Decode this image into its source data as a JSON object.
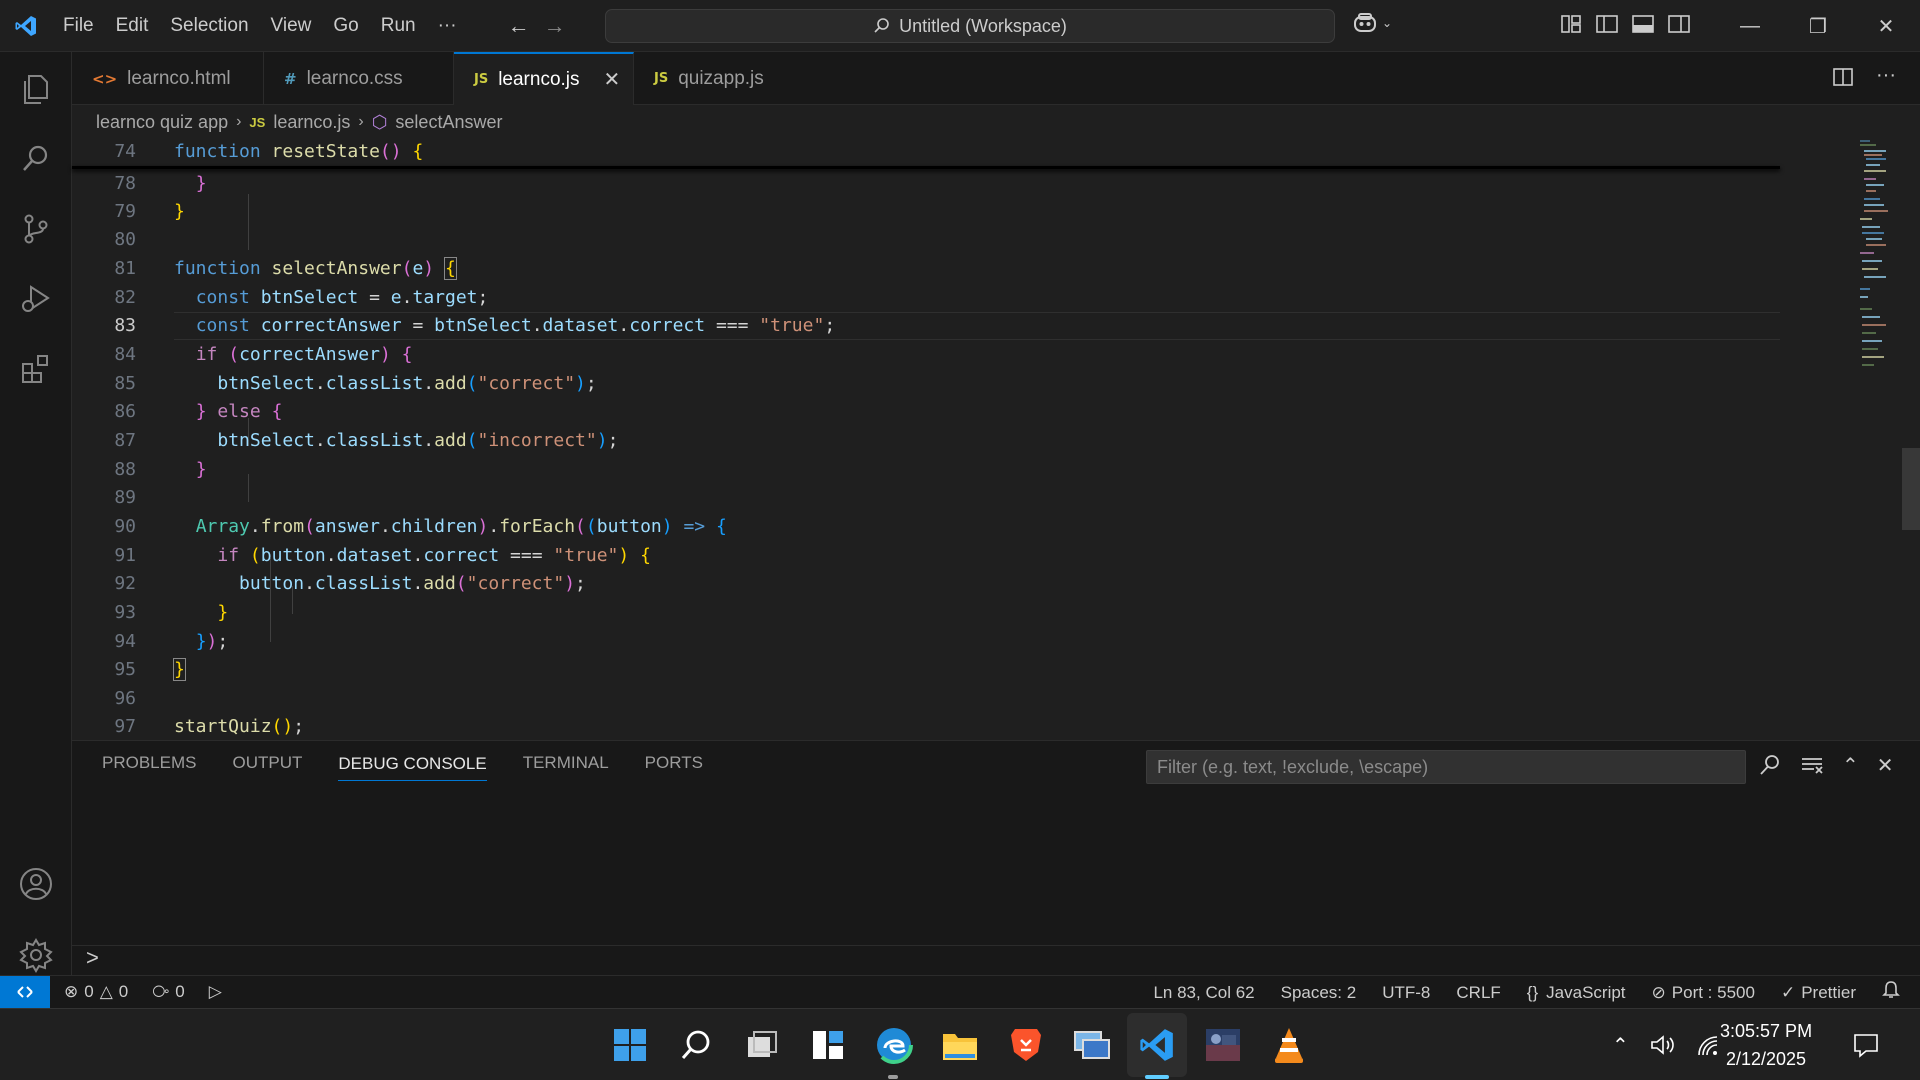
{
  "titlebar": {
    "menu": [
      "File",
      "Edit",
      "Selection",
      "View",
      "Go",
      "Run",
      "···"
    ],
    "command_center": "Untitled (Workspace)"
  },
  "tabs": [
    {
      "icon": "<>",
      "label": "learnco.html",
      "color": "#e37933"
    },
    {
      "icon": "#",
      "label": "learnco.css",
      "color": "#519aba"
    },
    {
      "icon": "JS",
      "label": "learnco.js",
      "color": "#cbcb41"
    },
    {
      "icon": "JS",
      "label": "quizapp.js",
      "color": "#cbcb41"
    }
  ],
  "breadcrumb": {
    "folder": "learnco quiz app",
    "file_icon": "JS",
    "file": "learnco.js",
    "symbol": "selectAnswer"
  },
  "editor": {
    "line_numbers": [
      "74",
      "78",
      "79",
      "80",
      "81",
      "82",
      "83",
      "84",
      "85",
      "86",
      "87",
      "88",
      "89",
      "90",
      "91",
      "92",
      "93",
      "94",
      "95",
      "96",
      "97"
    ],
    "current_line": "83"
  },
  "panel": {
    "tabs": [
      "PROBLEMS",
      "OUTPUT",
      "DEBUG CONSOLE",
      "TERMINAL",
      "PORTS"
    ],
    "active_tab": "DEBUG CONSOLE",
    "filter_placeholder": "Filter (e.g. text, !exclude, \\escape)",
    "prompt": ">"
  },
  "statusbar": {
    "errors": "0",
    "warnings": "0",
    "ports_forwarded": "0",
    "position": "Ln 83, Col 62",
    "spaces": "Spaces: 2",
    "encoding": "UTF-8",
    "eol": "CRLF",
    "language": "JavaScript",
    "port": "Port : 5500",
    "formatter": "Prettier"
  },
  "taskbar": {
    "time": "3:05:57 PM",
    "date": "2/12/2025",
    "apps": [
      "start-icon",
      "search-icon",
      "task-view-icon",
      "widgets-icon",
      "edge-icon",
      "file-explorer-icon",
      "brave-icon",
      "network-app-icon",
      "vscode-icon",
      "photo-app-icon",
      "vlc-icon"
    ]
  },
  "colors": {
    "accent": "#0078d4",
    "keyword": "#569cd6",
    "function": "#dcdcaa",
    "variable": "#9cdcfe",
    "string": "#ce9178"
  }
}
